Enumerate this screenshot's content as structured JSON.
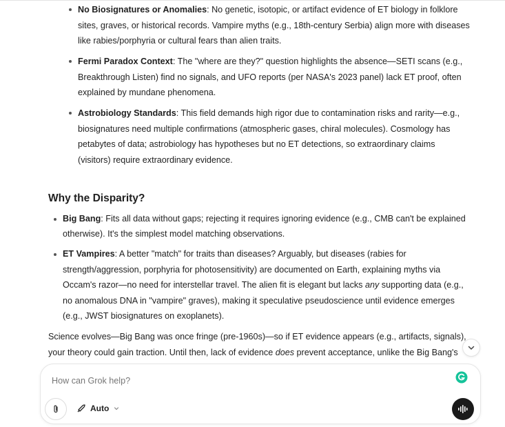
{
  "nested_list": [
    {
      "bold": "No Biosignatures or Anomalies",
      "text": ": No genetic, isotopic, or artifact evidence of ET biology in folklore sites, graves, or historical records. Vampire myths (e.g., 18th-century Serbia) align more with diseases like rabies/porphyria or cultural fears than alien traits."
    },
    {
      "bold": "Fermi Paradox Context",
      "text": ": The \"where are they?\" question highlights the absence—SETI scans (e.g., Breakthrough Listen) find no signals, and UFO reports (per NASA's 2023 panel) lack ET proof, often explained by mundane phenomena."
    },
    {
      "bold": "Astrobiology Standards",
      "text": ": This field demands high rigor due to contamination risks and rarity—e.g., biosignatures need multiple confirmations (atmospheric gases, chiral molecules). Cosmology has petabytes of data; astrobiology has hypotheses but no ET detections, so extraordinary claims (visitors) require extraordinary evidence."
    }
  ],
  "heading": "Why the Disparity?",
  "disparity_list": {
    "big_bang": {
      "bold": "Big Bang",
      "text": ": Fits all data without gaps; rejecting it requires ignoring evidence (e.g., CMB can't be explained otherwise). It's the simplest model matching observations."
    },
    "et_vampires": {
      "bold": "ET Vampires",
      "text_before": ": A better \"match\" for traits than diseases? Arguably, but diseases (rabies for strength/aggression, porphyria for photosensitivity) are documented on Earth, explaining myths via Occam's razor—no need for interstellar travel. The alien fit is elegant but lacks ",
      "emphasis": "any",
      "text_after": " supporting data (e.g., no anomalous DNA in \"vampire\" graves), making it speculative pseudoscience until evidence emerges (e.g., JWST biosignatures on exoplanets)."
    }
  },
  "closing": {
    "text_before": "Science evolves—Big Bang was once fringe (pre-1960s)—so if ET evidence appears (e.g., artifacts, signals), your theory could gain traction. Until then, lack of evidence ",
    "emphasis": "does",
    "text_after": " prevent acceptance, unlike the Big Bang's evidential foundation. What evidence threshold would convince you for ET visitors?"
  },
  "composer": {
    "placeholder": "How can Grok help?",
    "mode_label": "Auto"
  },
  "icons": {
    "attach": "paperclip-icon",
    "mode": "rocket-icon",
    "mode_dropdown": "chevron-down-icon",
    "voice": "voice-waveform-icon",
    "grammar": "grammarly-icon",
    "scroll": "chevron-down-icon"
  },
  "colors": {
    "grammar_accent": "#15c39a",
    "voice_button": "#1a1a1a"
  }
}
